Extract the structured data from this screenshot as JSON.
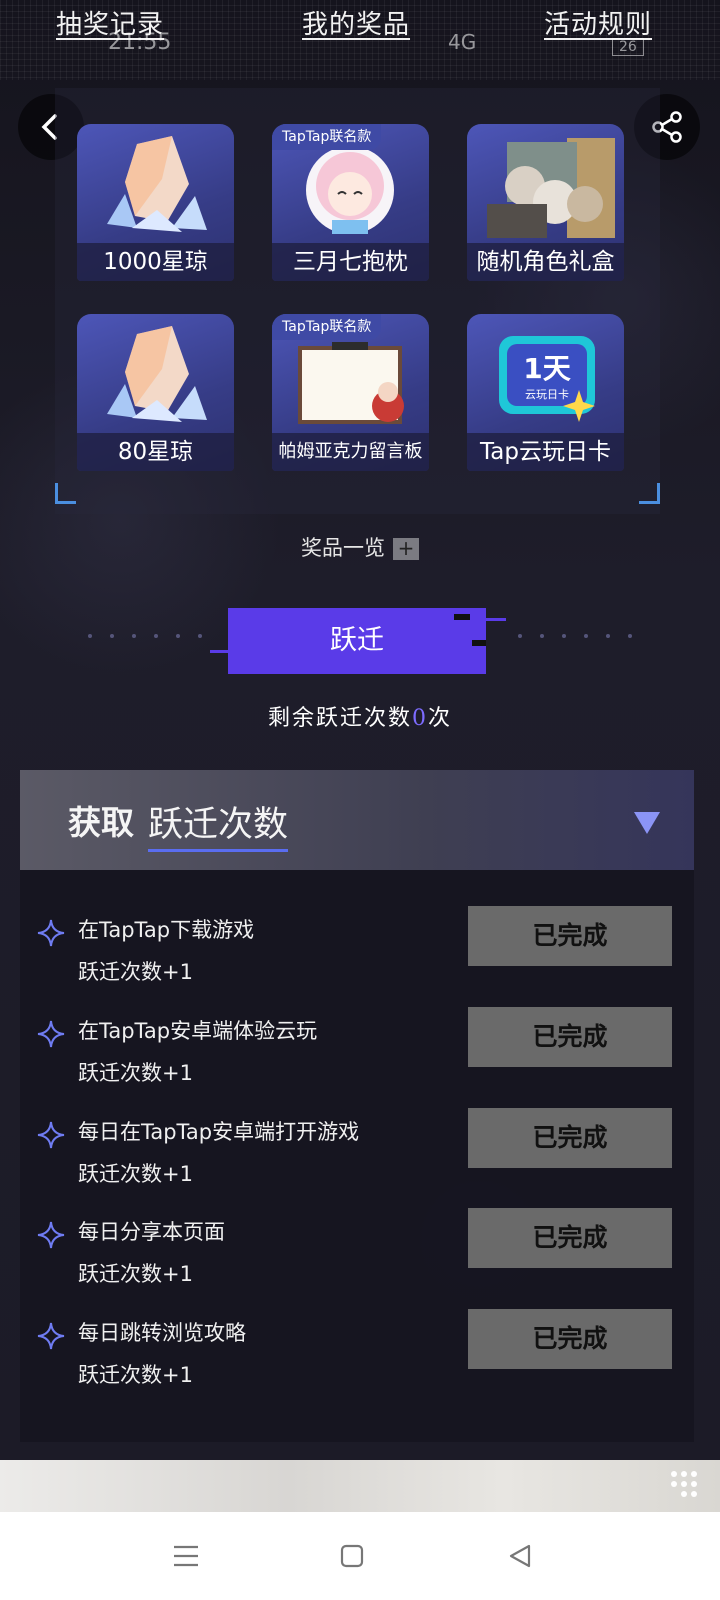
{
  "nav": {
    "draw_record": "抽奖记录",
    "my_prizes": "我的奖品",
    "rules": "活动规则"
  },
  "status_bar": {
    "time": "21:55",
    "signal": "4G",
    "battery": "26"
  },
  "prizes": [
    {
      "label": "1000星琼",
      "tag": ""
    },
    {
      "label": "三月七抱枕",
      "tag": "TapTap联名款"
    },
    {
      "label": "随机角色礼盒",
      "tag": ""
    },
    {
      "label": "80星琼",
      "tag": ""
    },
    {
      "label": "帕姆亚克力留言板",
      "tag": "TapTap联名款"
    },
    {
      "label": "Tap云玩日卡",
      "tag": ""
    }
  ],
  "card_art": {
    "days": "1天",
    "caption": "云玩日卡"
  },
  "overview_label": "奖品一览",
  "overview_plus": "+",
  "jump_button": "跃迁",
  "remaining": {
    "prefix": "剩余跃迁次数",
    "count": "0",
    "suffix": "次"
  },
  "task_section": {
    "title_bold": "获取",
    "title": "跃迁次数"
  },
  "tasks": [
    {
      "title": "在TapTap下载游戏",
      "reward": "跃迁次数+1",
      "status": "已完成"
    },
    {
      "title": "在TapTap安卓端体验云玩",
      "reward": "跃迁次数+1",
      "status": "已完成"
    },
    {
      "title": "每日在TapTap安卓端打开游戏",
      "reward": "跃迁次数+1",
      "status": "已完成"
    },
    {
      "title": "每日分享本页面",
      "reward": "跃迁次数+1",
      "status": "已完成"
    },
    {
      "title": "每日跳转浏览攻略",
      "reward": "跃迁次数+1",
      "status": "已完成"
    }
  ],
  "colors": {
    "accent": "#5a3be8",
    "remaining_num": "#7d6bff",
    "done_button": "#6a6a6a"
  },
  "icons": [
    "back-arrow-icon",
    "share-icon",
    "plus-icon",
    "star-icon",
    "dropdown-triangle-icon",
    "menu-icon",
    "home-icon",
    "back-nav-icon"
  ]
}
